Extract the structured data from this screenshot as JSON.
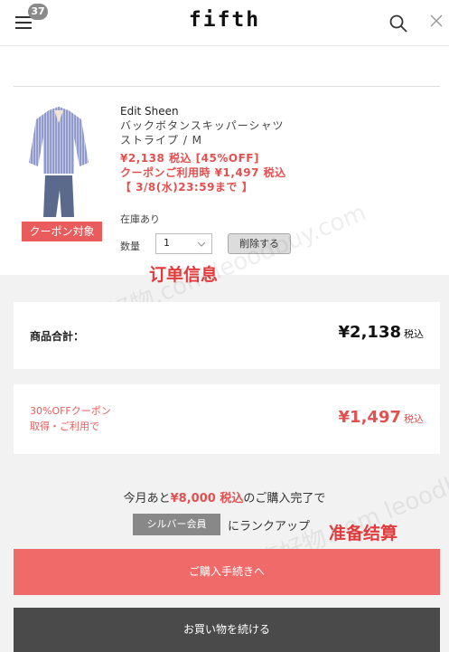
{
  "header": {
    "logo": "fifth",
    "cart_count": "37",
    "icons": [
      "menu-icon",
      "search-icon",
      "close-icon"
    ]
  },
  "product": {
    "brand": "Edit Sheen",
    "name": "バックボタンスキッパーシャツ",
    "variant": "ストライプ / M",
    "price": "¥2,138 税込 [45%OFF]",
    "coupon_price": "クーポンご利用時 ¥1,497 税込",
    "deadline": "【 3/8(水)23:59まで 】",
    "stock": "在庫あり",
    "qty_label": "数量",
    "qty_value": "1",
    "delete_label": "削除する",
    "coupon_tag": "クーポン対象"
  },
  "annotations": {
    "order_info": "订单信息",
    "checkout_prep": "准备结算",
    "watermark": "乐享好物.com  leoodbuy.com"
  },
  "summary": {
    "total_label": "商品合計：",
    "total_amount": "¥2,138",
    "tax": "税込",
    "coupon_line1": "30%OFFクーポン",
    "coupon_line2": "取得・ご利用で",
    "coupon_amount": "¥1,497"
  },
  "promo": {
    "prefix": "今月あと",
    "amount": "¥8,000 税込",
    "suffix": "のご購入完了で",
    "badge": "シルバー会員",
    "rank_up": "にランクアップ"
  },
  "buttons": {
    "checkout": "ご購入手続きへ",
    "continue": "お買い物を続ける"
  },
  "colors": {
    "accent": "#f06a6a",
    "price_red": "#e35050",
    "dark_button": "#4a4a4a"
  }
}
